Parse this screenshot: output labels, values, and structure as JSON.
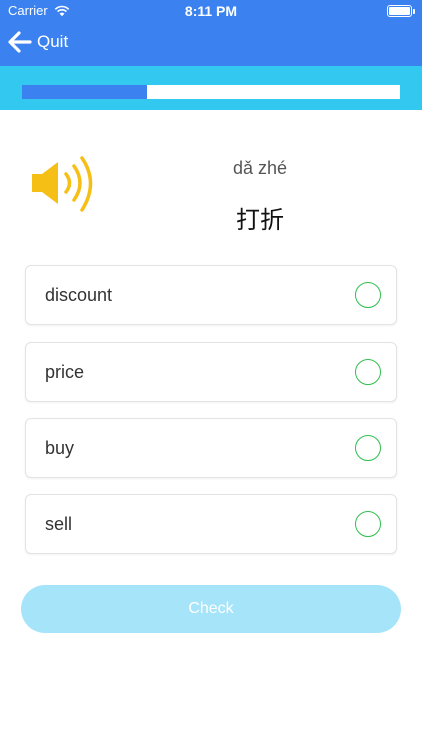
{
  "status_bar": {
    "carrier": "Carrier",
    "time": "8:11 PM"
  },
  "nav": {
    "back_label": "Quit"
  },
  "progress": {
    "fraction": 0.33
  },
  "question": {
    "pinyin": "dǎ zhé",
    "hanzi": "打折"
  },
  "options": [
    {
      "label": "discount"
    },
    {
      "label": "price"
    },
    {
      "label": "buy"
    },
    {
      "label": "sell"
    }
  ],
  "actions": {
    "check_label": "Check"
  },
  "colors": {
    "header": "#3b82f0",
    "progress_band": "#32c8f0",
    "progress_fill": "#3b82f0",
    "speaker": "#f6bf16",
    "radio": "#2fbf4e",
    "check_button": "#a6e4fa"
  },
  "icons": {
    "back": "arrow-left-icon",
    "speaker": "speaker-icon",
    "wifi": "wifi-icon",
    "battery": "battery-icon"
  }
}
